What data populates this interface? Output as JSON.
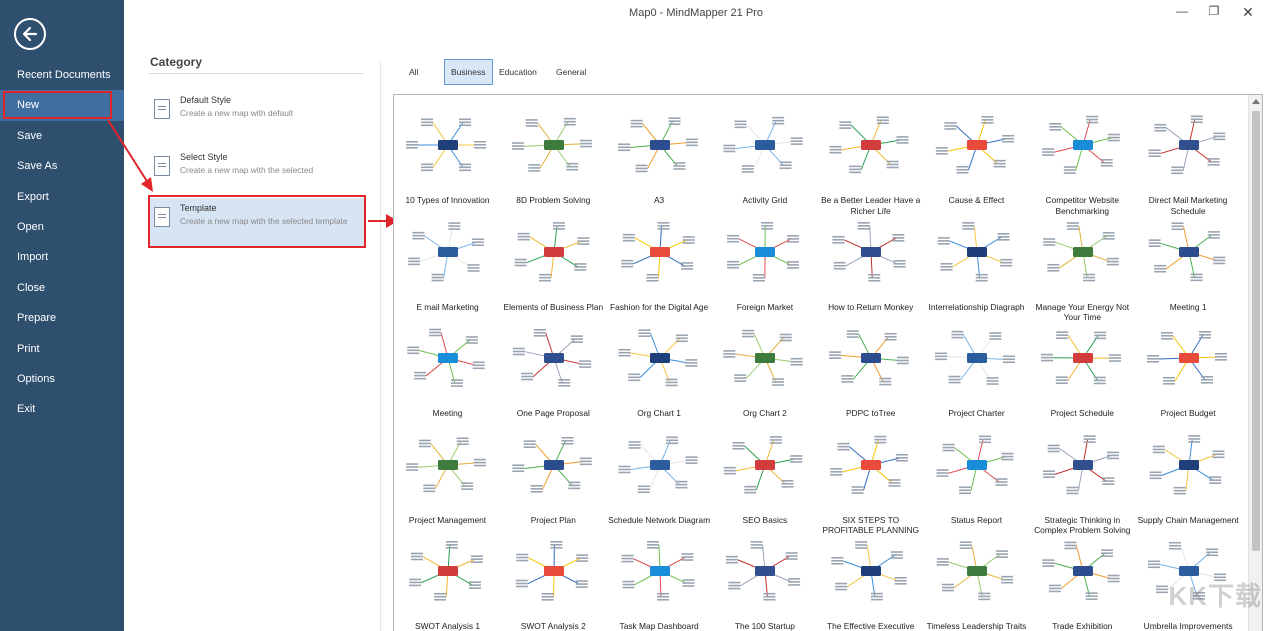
{
  "window": {
    "title": "Map0 - MindMapper 21 Pro"
  },
  "sidebar": {
    "items": [
      {
        "label": "Recent Documents",
        "id": "recent-documents"
      },
      {
        "label": "New",
        "id": "new"
      },
      {
        "label": "Save",
        "id": "save"
      },
      {
        "label": "Save As",
        "id": "save-as"
      },
      {
        "label": "Export",
        "id": "export"
      },
      {
        "label": "Open",
        "id": "open"
      },
      {
        "label": "Import",
        "id": "import"
      },
      {
        "label": "Close",
        "id": "close"
      },
      {
        "label": "Prepare",
        "id": "prepare"
      },
      {
        "label": "Print",
        "id": "print"
      },
      {
        "label": "Options",
        "id": "options"
      },
      {
        "label": "Exit",
        "id": "exit"
      }
    ],
    "selected": "New"
  },
  "category": {
    "heading": "Category",
    "items": [
      {
        "name": "Default Style",
        "desc": "Create a new map with default"
      },
      {
        "name": "Select Style",
        "desc": "Create a new map with the selected"
      },
      {
        "name": "Template",
        "desc": "Create a new map with the selected template"
      }
    ],
    "selected": "Template"
  },
  "tabs": [
    {
      "label": "All"
    },
    {
      "label": "Business"
    },
    {
      "label": "Education"
    },
    {
      "label": "General"
    }
  ],
  "active_tab": "Business",
  "templates": [
    "10 Types of Innovation",
    "8D  Problem Solving",
    "A3",
    "Activity Grid",
    "Be a Better Leader  Have a Richer Life",
    "Cause & Effect",
    "Competitor Website Benchmarking",
    "Direct Mail Marketing Schedule",
    "E mail Marketing",
    "Elements of  Business Plan",
    "Fashion for the Digital Age",
    "Foreign Market",
    "How to Return Monkey",
    "Interrelationship Diagraph",
    "Manage Your Energy  Not Your Time",
    "Meeting 1",
    "Meeting",
    "One Page Proposal",
    "Org Chart 1",
    "Org Chart 2",
    "PDPC toTree",
    "Project  Charter",
    "Project  Schedule",
    "Project Budget",
    "Project Management",
    "Project Plan",
    "Schedule Network Diagram",
    "SEO Basics",
    "SIX STEPS TO PROFITABLE PLANNING",
    "Status Report",
    "Strategic Thinking in Complex Problem Solving",
    "Supply Chain Management",
    "SWOT Analysis 1",
    "SWOT Analysis 2",
    "Task Map Dashboard",
    "The  100 Startup",
    "The Effective Executive",
    "Timeless Leadership Traits",
    "Trade Exhibition",
    "Umbrella Improvements"
  ],
  "watermark": "KK下载",
  "colors": {
    "sidebar": "#2f4f6f",
    "selected_nav": "#3f6ea0",
    "highlight": "#e0262b",
    "tab_active": "#d9e8f8"
  }
}
